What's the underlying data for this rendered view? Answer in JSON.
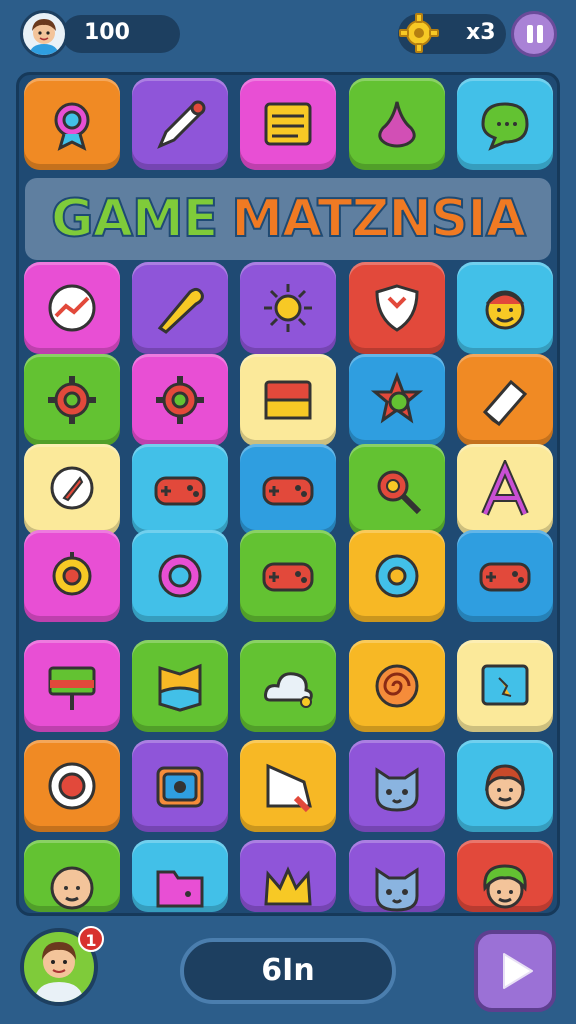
{
  "top_bar": {
    "score": "100",
    "multiplier": "x3",
    "gear_icon": "gear-icon",
    "pause_icon": "pause-icon",
    "avatar_icon": "avatar-icon"
  },
  "title": {
    "word_a": "GAME",
    "word_b": "MATZNSIA"
  },
  "colors": {
    "background": "#2c5d8a",
    "board": "#1f4a73",
    "orange": "#f08a24",
    "purple": "#8f55d9",
    "pink": "#e84fd4",
    "green": "#63c232",
    "cyan": "#42c0e8",
    "red": "#e2493b",
    "yellow": "#fbe99a",
    "gold": "#f7b825",
    "blue": "#2f9ee0"
  },
  "board": {
    "rows": [
      {
        "tiles": [
          {
            "color": "orange",
            "icon": "badge-icon"
          },
          {
            "color": "purple",
            "icon": "pencil-icon"
          },
          {
            "color": "pink",
            "icon": "notes-icon"
          },
          {
            "color": "green",
            "icon": "nose-icon"
          },
          {
            "color": "cyan",
            "icon": "chat-bubble-icon"
          }
        ]
      },
      {
        "tiles": [
          {
            "color": "pink",
            "icon": "trend-chart-icon"
          },
          {
            "color": "purple",
            "icon": "horn-icon"
          },
          {
            "color": "purple",
            "icon": "sun-icon"
          },
          {
            "color": "red",
            "icon": "shield-icon"
          },
          {
            "color": "cyan",
            "icon": "smiley-face-icon"
          }
        ]
      },
      {
        "tiles": [
          {
            "color": "green",
            "icon": "cog-icon"
          },
          {
            "color": "pink",
            "icon": "cog-icon"
          },
          {
            "color": "yellow",
            "icon": "window-icon"
          },
          {
            "color": "blue",
            "icon": "star-target-icon"
          },
          {
            "color": "orange",
            "icon": "eraser-icon"
          }
        ]
      },
      {
        "tiles": [
          {
            "color": "yellow",
            "icon": "chat-rocket-icon"
          },
          {
            "color": "cyan",
            "icon": "gamepad-icon"
          },
          {
            "color": "blue",
            "icon": "gamepad-icon"
          },
          {
            "color": "green",
            "icon": "magnifier-cog-icon"
          },
          {
            "color": "yellow",
            "icon": "letter-a-icon"
          }
        ]
      },
      {
        "tiles": [
          {
            "color": "pink",
            "icon": "lollipop-icon"
          },
          {
            "color": "cyan",
            "icon": "ring-icon"
          },
          {
            "color": "green",
            "icon": "gamepad-icon"
          },
          {
            "color": "gold",
            "icon": "flower-icon"
          },
          {
            "color": "blue",
            "icon": "gamepad-icon"
          }
        ]
      },
      {
        "tiles": [
          {
            "color": "pink",
            "icon": "signpost-icon"
          },
          {
            "color": "green",
            "icon": "cat-map-icon"
          },
          {
            "color": "green",
            "icon": "cloud-icon"
          },
          {
            "color": "gold",
            "icon": "spiral-icon"
          },
          {
            "color": "yellow",
            "icon": "picture-icon"
          }
        ]
      },
      {
        "tiles": [
          {
            "color": "orange",
            "icon": "record-icon"
          },
          {
            "color": "purple",
            "icon": "camera-icon"
          },
          {
            "color": "gold",
            "icon": "shape-icon"
          },
          {
            "color": "purple",
            "icon": "cat-face-icon"
          },
          {
            "color": "cyan",
            "icon": "boy-face-icon"
          }
        ]
      },
      {
        "tiles": [
          {
            "color": "green",
            "icon": "baby-face-icon"
          },
          {
            "color": "cyan",
            "icon": "folder-icon"
          },
          {
            "color": "purple",
            "icon": "crown-icon"
          },
          {
            "color": "purple",
            "icon": "cat-face-icon"
          },
          {
            "color": "red",
            "icon": "girl-face-icon"
          }
        ]
      }
    ]
  },
  "bottom_bar": {
    "notification_count": "1",
    "center_label": "6In",
    "play_icon": "play-icon",
    "avatar_icon": "avatar-icon"
  }
}
